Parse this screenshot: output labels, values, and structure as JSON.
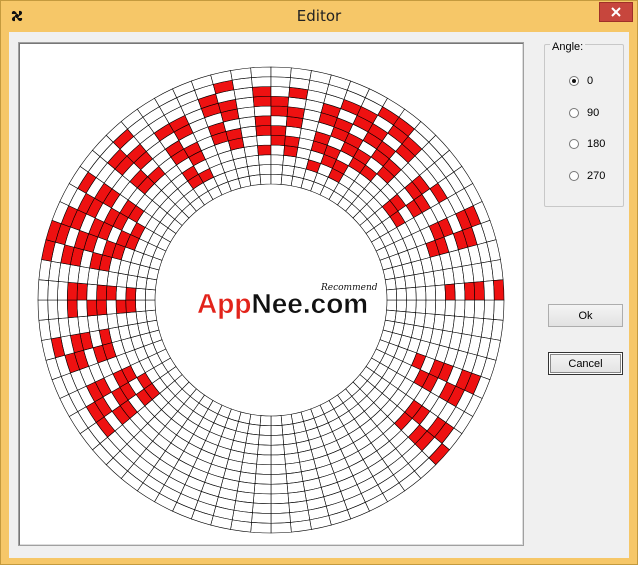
{
  "window": {
    "title": "Editor",
    "app_icon": "fan-icon",
    "close_icon": "close-icon"
  },
  "canvas": {
    "ring_segments": 72,
    "ring_rows": 12,
    "logo": {
      "text_a": "A",
      "text_pp": "pp",
      "text_n": "N",
      "text_ee": "ee",
      "text_com": ".com",
      "tag": "Recommend"
    },
    "colors": {
      "filled": "#ee1111",
      "empty": "#ffffff",
      "grid": "#000000",
      "logo_red": "#e2231a",
      "logo_dark": "#111111"
    }
  },
  "angle": {
    "label": "Angle:",
    "options": [
      "0",
      "90",
      "180",
      "270"
    ],
    "selected": "0"
  },
  "buttons": {
    "ok": "Ok",
    "cancel": "Cancel"
  }
}
